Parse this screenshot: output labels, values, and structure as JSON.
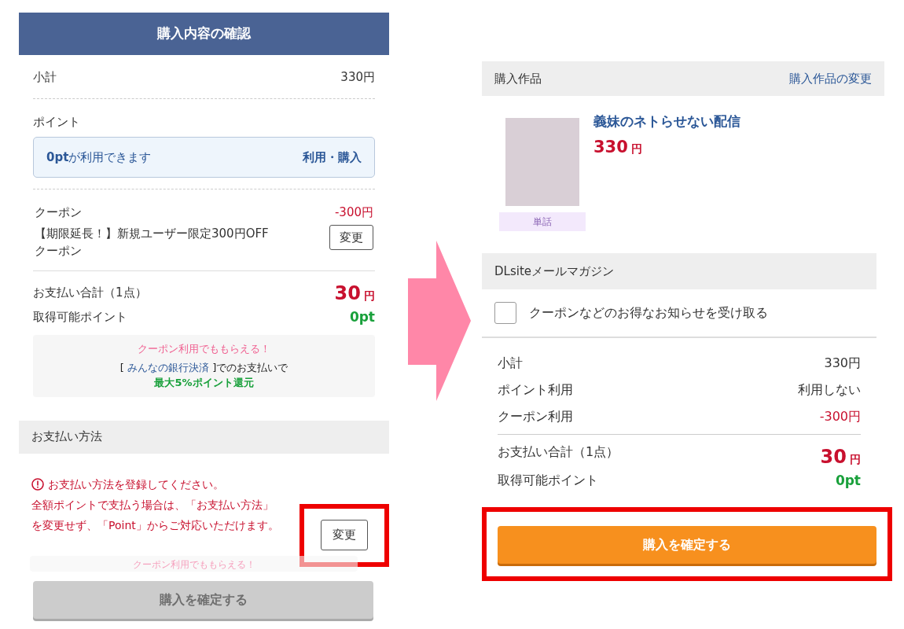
{
  "left": {
    "title": "購入内容の確認",
    "subtotal": {
      "label": "小計",
      "value": "330円"
    },
    "points": {
      "label": "ポイント",
      "amount": "0pt",
      "text": "が利用できます",
      "action": "利用・購入"
    },
    "coupon": {
      "label": "クーポン",
      "amount": "-300円",
      "name": "【期限延長！】新規ユーザー限定300円OFFクーポン",
      "button": "変更"
    },
    "total": {
      "label": "お支払い合計（1点）",
      "amount": "30",
      "unit": "円"
    },
    "earn": {
      "label": "取得可能ポイント",
      "value": "0pt"
    },
    "promo": {
      "headline": "クーポン利用でももらえる！",
      "open": "[",
      "link": "みんなの銀行決済",
      "rest": "]でのお支払いで",
      "highlight": "最大5%ポイント還元"
    },
    "payment": {
      "title": "お支払い方法",
      "warning": [
        "お支払い方法を登録してください。",
        "全額ポイントで支払う場合は、「お支払い方法」",
        "を変更せず、「Point」からご対応いただけます。"
      ],
      "button": "変更",
      "highlighted": true
    },
    "faded_promo": {
      "headline": "クーポン利用でももらえる！"
    },
    "confirm": {
      "label": "購入を確定する",
      "disabled": true,
      "highlighted": false
    }
  },
  "right": {
    "section_title": "購入作品",
    "change_link": "購入作品の変更",
    "product": {
      "title": "義妹のネトらせない配信",
      "price": "330",
      "unit": "円",
      "tag": "単話"
    },
    "newsletter": {
      "title": "DLsiteメールマガジン",
      "checkbox": {
        "label": "クーポンなどのお得なお知らせを受け取る",
        "checked": false
      }
    },
    "rows": [
      {
        "label": "小計",
        "value": "330円",
        "kind": "normal"
      },
      {
        "label": "ポイント利用",
        "value": "利用しない",
        "kind": "normal"
      },
      {
        "label": "クーポン利用",
        "value": "-300円",
        "kind": "discount"
      }
    ],
    "total": {
      "label": "お支払い合計（1点）",
      "amount": "30",
      "unit": "円"
    },
    "earn": {
      "label": "取得可能ポイント",
      "value": "0pt"
    },
    "confirm": {
      "label": "購入を確定する",
      "disabled": false,
      "highlighted": true
    }
  }
}
